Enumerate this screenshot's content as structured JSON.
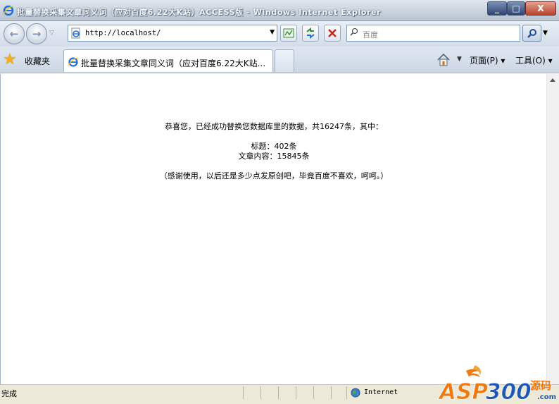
{
  "window": {
    "title": "批量替换采集文章同义词（应对百度6.22大K站）ACCESS版 - Windows Internet Explorer",
    "minimize_label": "_",
    "maximize_label": "□",
    "close_label": "X"
  },
  "toolbar": {
    "back_label": "←",
    "forward_label": "→",
    "history_dropdown": "▽",
    "url": "http://localhost/",
    "url_dropdown": "▼",
    "search_placeholder": "百度",
    "search_dropdown": "▼"
  },
  "tabs": {
    "favorites_label": "收藏夹",
    "active_tab_label": "批量替换采集文章同义词（应对百度6.22大K站...",
    "page_menu_label": "页面(P) ▾",
    "tools_menu_label": "工具(O) ▾",
    "home_dropdown": "▼"
  },
  "content": {
    "line1": "恭喜您，已经成功替换您数据库里的数据，共16247条，其中：",
    "line2": "标题：402条",
    "line3": "文章内容：15845条",
    "line4": "（感谢使用，以后还是多少点发原创吧，毕竟百度不喜欢，呵呵。）"
  },
  "statusbar": {
    "status_text": "完成",
    "zone_text": "Internet"
  },
  "watermark": {
    "brand": "ASP300",
    "sub": "源码"
  },
  "colors": {
    "title_text": "#f4f7fb",
    "close_button": "#b7432c",
    "star": "#f2b01e",
    "watermark_orange": "#f07a12",
    "watermark_blue": "#1f58b5"
  }
}
